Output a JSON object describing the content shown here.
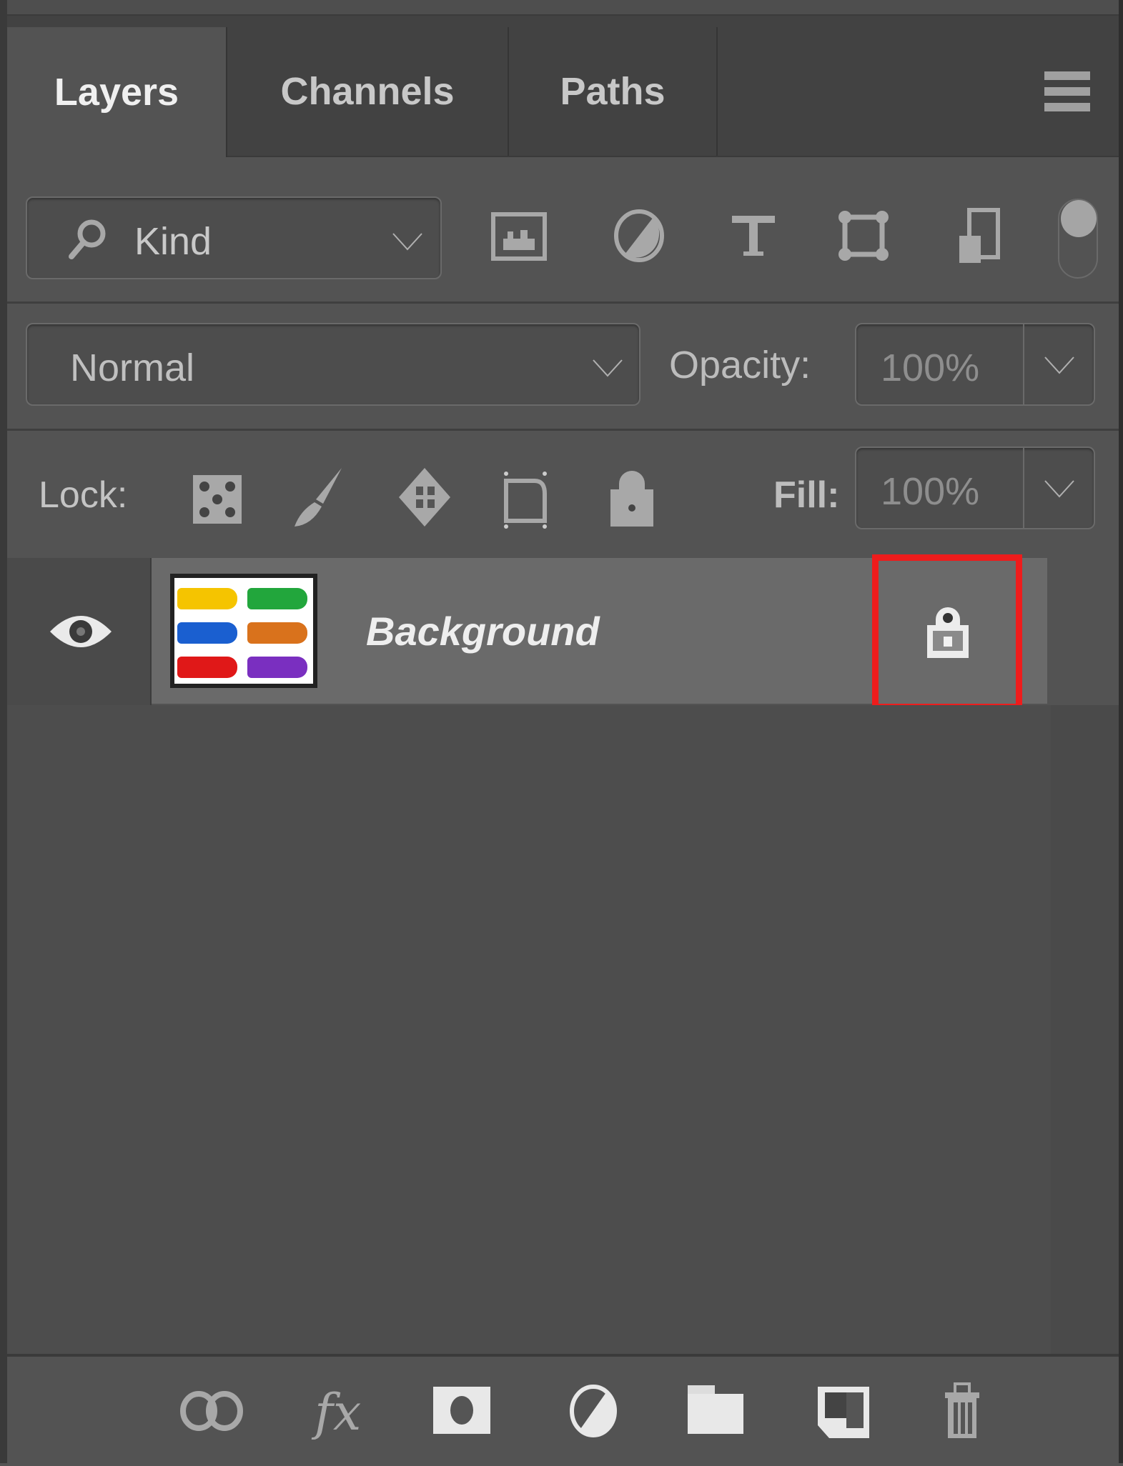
{
  "panel": {
    "tabs": [
      {
        "label": "Layers",
        "active": true
      },
      {
        "label": "Channels",
        "active": false
      },
      {
        "label": "Paths",
        "active": false
      }
    ],
    "menu_icon": "panel-menu-icon"
  },
  "filter": {
    "kind_label": "Kind",
    "search_icon": "search-icon",
    "filter_icons": [
      "pixel-layer-filter-icon",
      "adjustment-layer-filter-icon",
      "type-layer-filter-icon",
      "shape-layer-filter-icon",
      "smart-object-filter-icon"
    ],
    "filter_toggle": "filter-toggle"
  },
  "blend": {
    "mode": "Normal",
    "opacity_label": "Opacity:",
    "opacity_value": "100%"
  },
  "lock": {
    "label": "Lock:",
    "icons": [
      "lock-transparent-pixels-icon",
      "lock-image-pixels-icon",
      "lock-position-icon",
      "lock-artboard-icon",
      "lock-all-icon"
    ],
    "fill_label": "Fill:",
    "fill_value": "100%"
  },
  "layers": [
    {
      "name": "Background",
      "visible": true,
      "locked": true,
      "thumbnail_colors": [
        "#f5c400",
        "#22a63c",
        "#1a5fd0",
        "#d9721c",
        "#e01818",
        "#7a2fc0"
      ]
    }
  ],
  "highlight": {
    "color": "#ee1c1c",
    "target": "layer-lock-icon"
  },
  "bottom_tools": [
    "link-layers-icon",
    "fx-icon",
    "add-mask-icon",
    "adjustment-layer-icon",
    "new-group-icon",
    "new-layer-icon",
    "delete-layer-icon"
  ]
}
